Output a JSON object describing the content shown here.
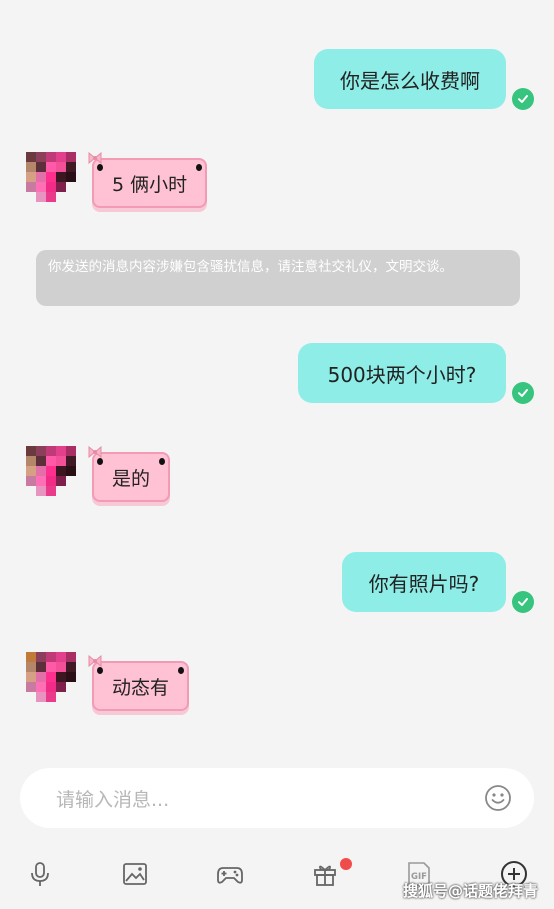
{
  "messages": [
    {
      "id": "m1",
      "direction": "outgoing",
      "text": "你是怎么收费啊",
      "status": "delivered"
    },
    {
      "id": "m2",
      "direction": "incoming",
      "text": "5 俩小时"
    },
    {
      "id": "notice",
      "direction": "system",
      "text": "你发送的消息内容涉嫌包含骚扰信息，请注意社交礼仪，文明交谈。"
    },
    {
      "id": "m3",
      "direction": "outgoing",
      "text": "500块两个小时?",
      "status": "delivered"
    },
    {
      "id": "m4",
      "direction": "incoming",
      "text": "是的"
    },
    {
      "id": "m5",
      "direction": "outgoing",
      "text": "你有照片吗?",
      "status": "delivered"
    },
    {
      "id": "m6",
      "direction": "incoming",
      "text": "动态有"
    }
  ],
  "composer": {
    "placeholder": "请输入消息...",
    "emoji_icon": "smiley-icon"
  },
  "toolbar": {
    "items": [
      {
        "icon": "microphone-icon"
      },
      {
        "icon": "image-icon"
      },
      {
        "icon": "gamepad-icon"
      },
      {
        "icon": "gift-icon",
        "badge": "red-dot"
      },
      {
        "icon": "gif-icon",
        "label": "GIF"
      },
      {
        "icon": "plus-circle-icon"
      }
    ]
  },
  "watermark": "搜狐号@话题佬拜青",
  "colors": {
    "outgoing_bubble": "#8eede7",
    "incoming_bubble": "#ffc2d4",
    "incoming_border": "#f39ab4",
    "check": "#36c47f",
    "notice_bg": "#d0d0d0",
    "badge": "#f24b4b"
  }
}
